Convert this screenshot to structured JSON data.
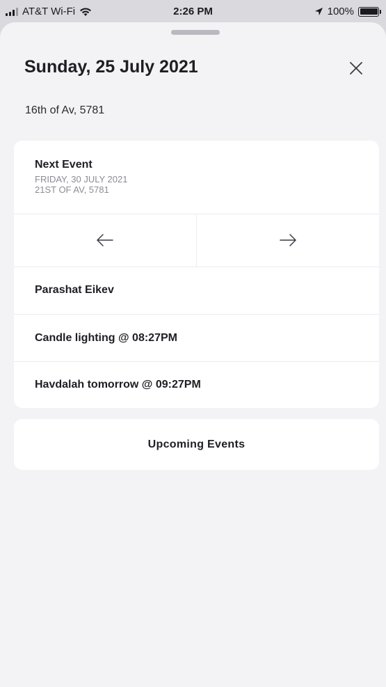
{
  "status_bar": {
    "carrier": "AT&T Wi-Fi",
    "time": "2:26 PM",
    "battery": "100%"
  },
  "header": {
    "title": "Sunday, 25 July 2021",
    "hebrew_date": "16th of Av, 5781"
  },
  "next_event": {
    "label": "Next Event",
    "date": "FRIDAY, 30 JULY 2021",
    "hebrew_date": "21ST OF AV, 5781"
  },
  "events": [
    "Parashat Eikev",
    "Candle lighting @ 08:27PM",
    "Havdalah tomorrow @ 09:27PM"
  ],
  "upcoming": {
    "label": "Upcoming Events"
  },
  "icons": {
    "close": "close-icon",
    "prev": "arrow-left-icon",
    "next": "arrow-right-icon"
  },
  "colors": {
    "background": "#f3f3f5",
    "card": "#ffffff",
    "text": "#1e1e24",
    "muted": "#8b8b94"
  }
}
